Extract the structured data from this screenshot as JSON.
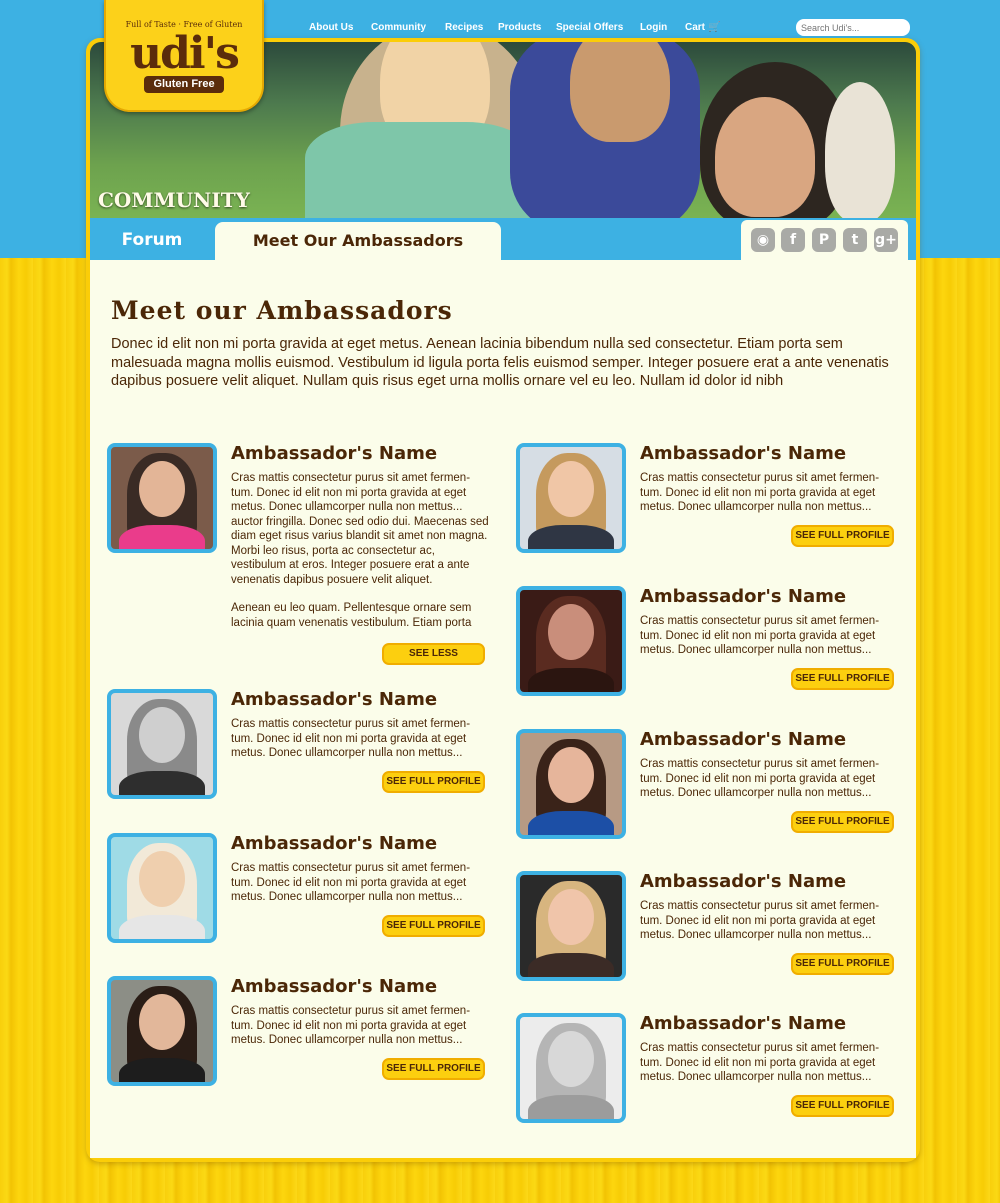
{
  "nav": {
    "items": [
      "About Us",
      "Community",
      "Recipes",
      "Products",
      "Special Offers",
      "Login",
      "Cart"
    ],
    "search_placeholder": "Search Udi's..."
  },
  "logo": {
    "tagline": "Full of Taste · Free of Gluten",
    "word": "udi's",
    "sub": "Gluten Free"
  },
  "hero": {
    "title": "COMMUNITY"
  },
  "tabs": {
    "forum": "Forum",
    "ambassadors": "Meet Our Ambassadors"
  },
  "social": [
    "instagram-icon",
    "facebook-icon",
    "pinterest-icon",
    "twitter-icon",
    "google-plus-icon"
  ],
  "page": {
    "title": "Meet our Ambassadors",
    "intro": "Donec id elit non mi porta gravida at eget metus. Aenean lacinia bibendum nulla sed consectetur. Etiam porta sem malesuada magna mollis euismod. Vestibulum id ligula porta felis euismod semper. Integer posuere erat a ante venenatis dapibus posuere velit aliquet. Nullam quis risus eget urna mollis ornare vel eu leo. Nullam id dolor id nibh"
  },
  "ambassadors": {
    "expanded": {
      "name": "Ambassador's Name",
      "text1": "Cras mattis consectetur purus sit amet fermen-tum. Donec id elit non mi porta gravida at eget metus. Donec ullamcorper nulla non mettus... auctor fringilla. Donec sed odio dui. Maecenas sed diam eget risus varius blandit sit amet non magna. Morbi leo risus, porta ac consectetur ac, vestibulum at eros. Integer posuere erat a ante venenatis dapibus posuere velit aliquet.",
      "text2": "Aenean eu leo quam. Pellentesque ornare sem lacinia quam venenatis vestibulum. Etiam porta",
      "button": "SEE LESS"
    },
    "name": "Ambassador's Name",
    "text": "Cras mattis consectetur purus sit amet fermen-tum. Donec id elit non mi porta gravida at eget metus. Donec ullamcorper nulla non mettus...",
    "button": "SEE FULL PROFILE"
  }
}
